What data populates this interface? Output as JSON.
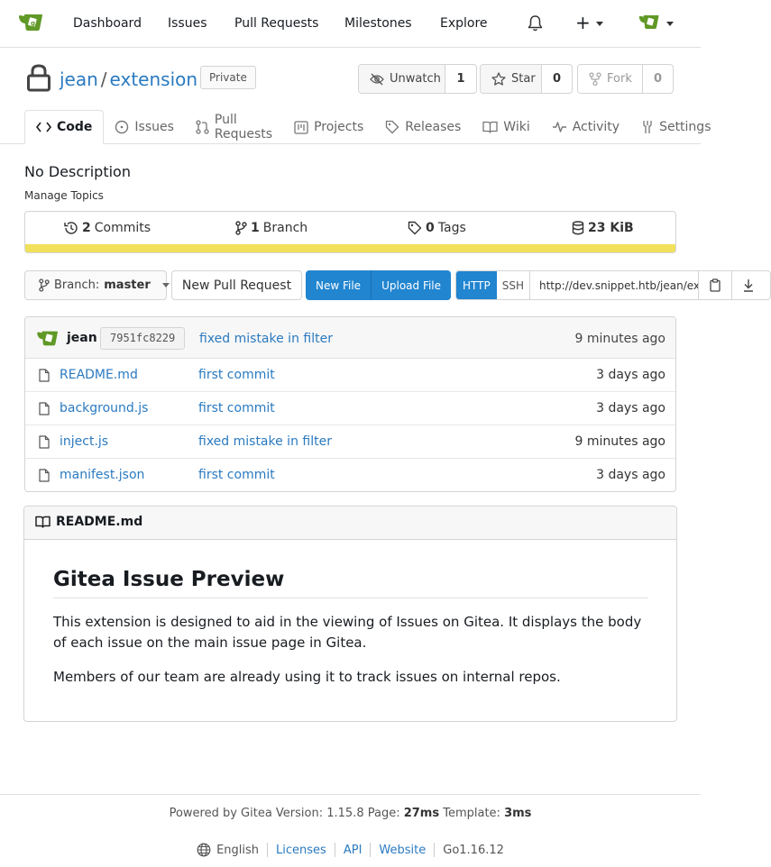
{
  "nav": {
    "items": [
      "Dashboard",
      "Issues",
      "Pull Requests",
      "Milestones",
      "Explore"
    ],
    "plus": "+"
  },
  "repo": {
    "owner": "jean",
    "separator": "/",
    "name": "extension",
    "visibility": "Private",
    "watch": {
      "label": "Unwatch",
      "count": "1"
    },
    "star": {
      "label": "Star",
      "count": "0"
    },
    "fork": {
      "label": "Fork",
      "count": "0"
    }
  },
  "tabs": [
    "Code",
    "Issues",
    "Pull Requests",
    "Projects",
    "Releases",
    "Wiki",
    "Activity",
    "Settings"
  ],
  "description": "No Description",
  "manage_topics": "Manage Topics",
  "stats": {
    "commits": {
      "count": "2",
      "label": "Commits"
    },
    "branches": {
      "count": "1",
      "label": "Branch"
    },
    "tags": {
      "count": "0",
      "label": "Tags"
    },
    "size": "23 KiB",
    "language_color": "#f1e05a"
  },
  "actions": {
    "branch_label": "Branch:",
    "branch_value": "master",
    "new_pr": "New Pull Request",
    "new_file": "New File",
    "upload_file": "Upload File",
    "http": "HTTP",
    "ssh": "SSH",
    "clone_url": "http://dev.snippet.htb/jean/extension.git"
  },
  "latest_commit": {
    "user": "jean",
    "sha": "7951fc8229",
    "message": "fixed mistake in filter",
    "time": "9 minutes ago"
  },
  "files": [
    {
      "name": "README.md",
      "message": "first commit",
      "time": "3 days ago"
    },
    {
      "name": "background.js",
      "message": "first commit",
      "time": "3 days ago"
    },
    {
      "name": "inject.js",
      "message": "fixed mistake in filter",
      "time": "9 minutes ago"
    },
    {
      "name": "manifest.json",
      "message": "first commit",
      "time": "3 days ago"
    }
  ],
  "readme": {
    "filename": "README.md",
    "heading": "Gitea Issue Preview",
    "paragraph1": "This extension is designed to aid in the viewing of Issues on Gitea. It displays the body of each issue on the main issue page in Gitea.",
    "paragraph2": "Members of our team are already using it to track issues on internal repos."
  },
  "footer": {
    "powered": "Powered by Gitea Version: 1.15.8 Page:",
    "page_time": "27ms",
    "template_label": "Template:",
    "template_time": "3ms",
    "language": "English",
    "licenses": "Licenses",
    "api": "API",
    "website": "Website",
    "go_version": "Go1.16.12"
  },
  "colors": {
    "link": "#2a7ac0",
    "primary": "#2185d0",
    "gitea_green": "#609926"
  }
}
